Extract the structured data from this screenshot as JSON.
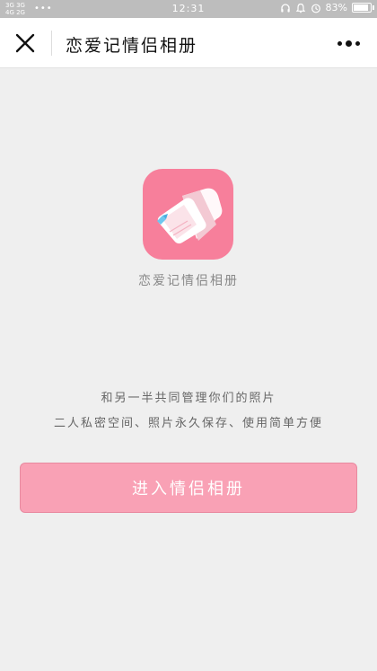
{
  "status_bar": {
    "network_top": "3G 3G",
    "network_bottom": "4G 2G",
    "dots": "•••",
    "time": "12:31",
    "battery": "83%",
    "icons": [
      "headset-icon",
      "alarm-icon",
      "clock-icon",
      "battery-icon"
    ]
  },
  "nav": {
    "title": "恋爱记情侣相册",
    "close_icon": "close-icon",
    "more_icon": "more-dots-icon"
  },
  "app": {
    "name": "恋爱记情侣相册",
    "icon": "album-heart-icon",
    "icon_color": "#f77f9b"
  },
  "description": {
    "line1": "和另一半共同管理你们的照片",
    "line2": "二人私密空间、照片永久保存、使用简单方便"
  },
  "enter_button": {
    "label": "进入情侣相册",
    "color": "#f9a1b5"
  }
}
